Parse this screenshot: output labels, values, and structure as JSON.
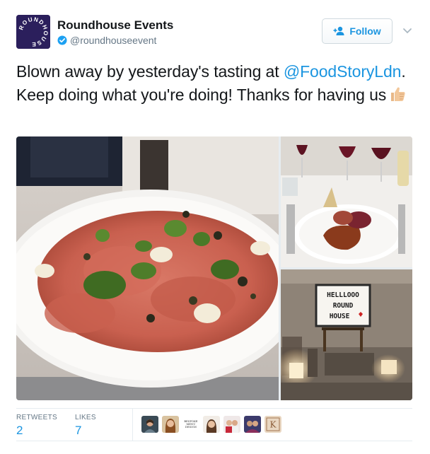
{
  "user": {
    "display_name": "Roundhouse Events",
    "handle": "@roundhouseevent",
    "avatar_logo_text": "ROUNDHOUSE",
    "verified": true
  },
  "follow_button": {
    "label": "Follow"
  },
  "tweet": {
    "text_part1": "Blown away by yesterday's tasting at ",
    "mention": "@FoodStoryLdn",
    "text_part2": ". Keep doing what you're doing! Thanks for having us",
    "emoji": "thumbs-up-icon"
  },
  "media": {
    "photos": [
      {
        "name": "beef-carpaccio-photo"
      },
      {
        "name": "plated-dish-wine-photo"
      },
      {
        "name": "lightbox-sign-photo",
        "sign_lines": [
          "HELLLOOO",
          "ROUND",
          "HOUSE"
        ]
      }
    ]
  },
  "stats": {
    "retweets_label": "RETWEETS",
    "retweets_count": "2",
    "likes_label": "LIKES",
    "likes_count": "7"
  },
  "likers": {
    "bespoke_text": "BESPOKE MENU DESIGN",
    "k_logo": "K"
  },
  "colors": {
    "link": "#1b95e0",
    "text": "#14171a",
    "muted": "#657786",
    "avatar_bg": "#2b1f5c"
  }
}
